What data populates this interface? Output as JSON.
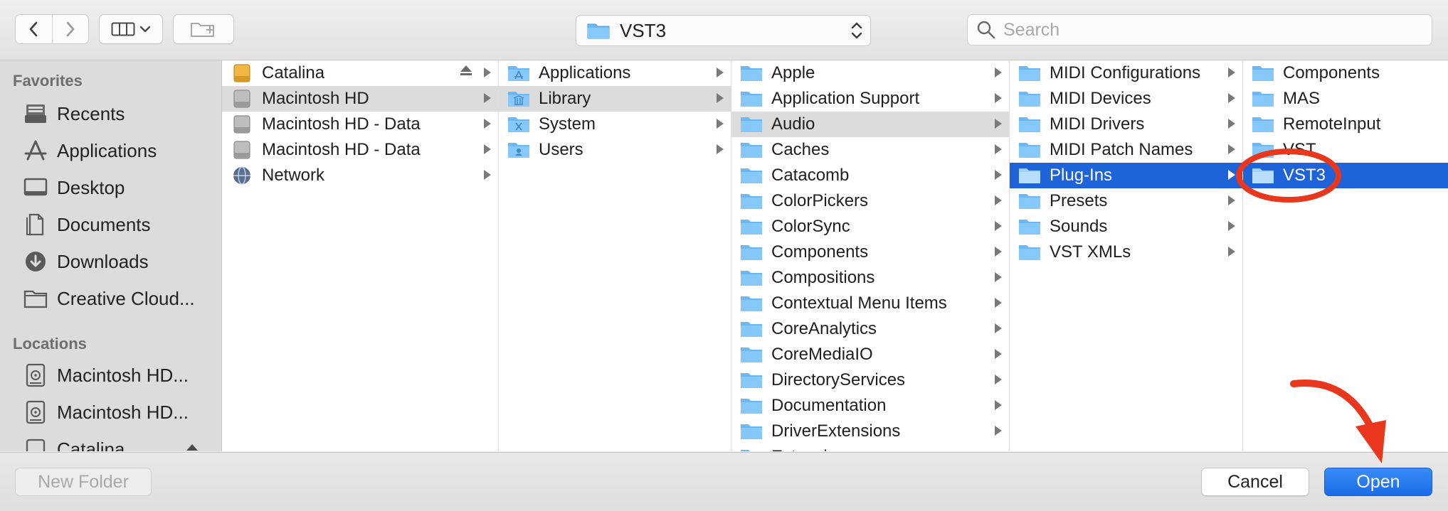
{
  "toolbar": {
    "path_popup_label": "VST3",
    "search_placeholder": "Search"
  },
  "sidebar": {
    "favorites_title": "Favorites",
    "favorites": [
      {
        "label": "Recents",
        "icon": "recents-icon"
      },
      {
        "label": "Applications",
        "icon": "applications-icon"
      },
      {
        "label": "Desktop",
        "icon": "desktop-icon"
      },
      {
        "label": "Documents",
        "icon": "documents-icon"
      },
      {
        "label": "Downloads",
        "icon": "downloads-icon"
      },
      {
        "label": "Creative Cloud...",
        "icon": "folder-icon"
      }
    ],
    "locations_title": "Locations",
    "locations": [
      {
        "label": "Macintosh HD...",
        "icon": "hard-drive-icon"
      },
      {
        "label": "Macintosh HD...",
        "icon": "hard-drive-icon"
      },
      {
        "label": "Catalina",
        "icon": "external-drive-icon"
      }
    ]
  },
  "columns": {
    "col1": [
      {
        "label": "Catalina",
        "icon": "external-drive-icon",
        "eject": true
      },
      {
        "label": "Macintosh HD",
        "icon": "hard-drive-icon",
        "state": "path"
      },
      {
        "label": "Macintosh HD - Data",
        "icon": "hard-drive-icon"
      },
      {
        "label": "Macintosh HD - Data",
        "icon": "hard-drive-icon"
      },
      {
        "label": "Network",
        "icon": "network-globe-icon"
      }
    ],
    "col2": [
      {
        "label": "Applications",
        "icon": "applications-folder-icon"
      },
      {
        "label": "Library",
        "icon": "library-folder-icon",
        "state": "path"
      },
      {
        "label": "System",
        "icon": "system-folder-icon"
      },
      {
        "label": "Users",
        "icon": "users-folder-icon"
      }
    ],
    "col3": [
      {
        "label": "Apple"
      },
      {
        "label": "Application Support"
      },
      {
        "label": "Audio",
        "state": "path"
      },
      {
        "label": "Caches"
      },
      {
        "label": "Catacomb"
      },
      {
        "label": "ColorPickers"
      },
      {
        "label": "ColorSync"
      },
      {
        "label": "Components"
      },
      {
        "label": "Compositions"
      },
      {
        "label": "Contextual Menu Items"
      },
      {
        "label": "CoreAnalytics"
      },
      {
        "label": "CoreMediaIO"
      },
      {
        "label": "DirectoryServices"
      },
      {
        "label": "Documentation"
      },
      {
        "label": "DriverExtensions"
      },
      {
        "label": "Extensions"
      }
    ],
    "col4": [
      {
        "label": "MIDI Configurations"
      },
      {
        "label": "MIDI Devices"
      },
      {
        "label": "MIDI Drivers"
      },
      {
        "label": "MIDI Patch Names"
      },
      {
        "label": "Plug-Ins",
        "state": "selected"
      },
      {
        "label": "Presets"
      },
      {
        "label": "Sounds"
      },
      {
        "label": "VST XMLs"
      }
    ],
    "col5": [
      {
        "label": "Components"
      },
      {
        "label": "MAS"
      },
      {
        "label": "RemoteInput"
      },
      {
        "label": "VST"
      },
      {
        "label": "VST3",
        "state": "selected"
      }
    ]
  },
  "bottom": {
    "new_folder_label": "New Folder",
    "cancel_label": "Cancel",
    "open_label": "Open"
  },
  "colors": {
    "selection": "#1f63d9",
    "folder": "#6cb8f4",
    "annotation_red": "#e8371c"
  }
}
